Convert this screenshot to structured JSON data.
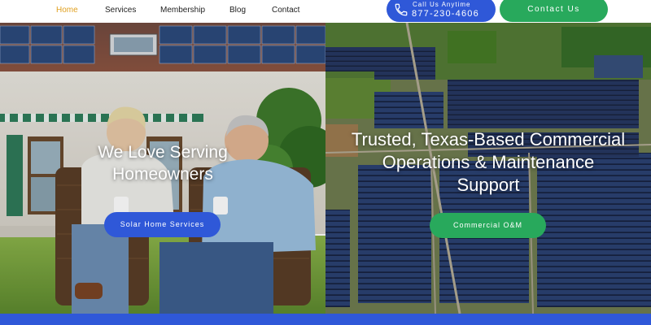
{
  "nav": {
    "items": [
      {
        "label": "Home",
        "active": true
      },
      {
        "label": "Services",
        "active": false
      },
      {
        "label": "Membership",
        "active": false
      },
      {
        "label": "Blog",
        "active": false
      },
      {
        "label": "Contact",
        "active": false
      }
    ],
    "active_color": "#e0a020"
  },
  "header": {
    "call_label": "Call Us Anytime",
    "phone": "877-230-4606",
    "phone_icon": "phone-icon",
    "contact_label": "Contact Us"
  },
  "hero_left": {
    "title": "We Love Serving Homeowners",
    "button_label": "Solar Home Services"
  },
  "hero_right": {
    "title": "Trusted, Texas-Based Commercial Operations & Maintenance Support",
    "button_label": "Commercial O&M"
  },
  "colors": {
    "primary_blue": "#2f58d8",
    "primary_green": "#28a95c"
  }
}
